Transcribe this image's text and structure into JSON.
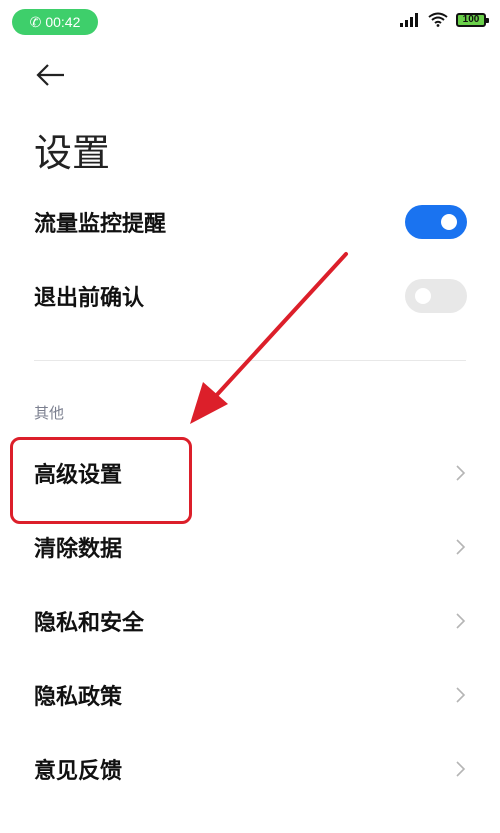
{
  "status_bar": {
    "call_time": "00:42",
    "battery": "100"
  },
  "page": {
    "title": "设置"
  },
  "toggles": [
    {
      "label": "流量监控提醒",
      "on": true
    },
    {
      "label": "退出前确认",
      "on": false
    }
  ],
  "section": {
    "title": "其他",
    "items": [
      {
        "label": "高级设置"
      },
      {
        "label": "清除数据"
      },
      {
        "label": "隐私和安全"
      },
      {
        "label": "隐私政策"
      },
      {
        "label": "意见反馈"
      }
    ]
  },
  "colors": {
    "accent": "#1a73f0",
    "annotation": "#dc1f2a",
    "call_pill": "#3ecf6b"
  }
}
